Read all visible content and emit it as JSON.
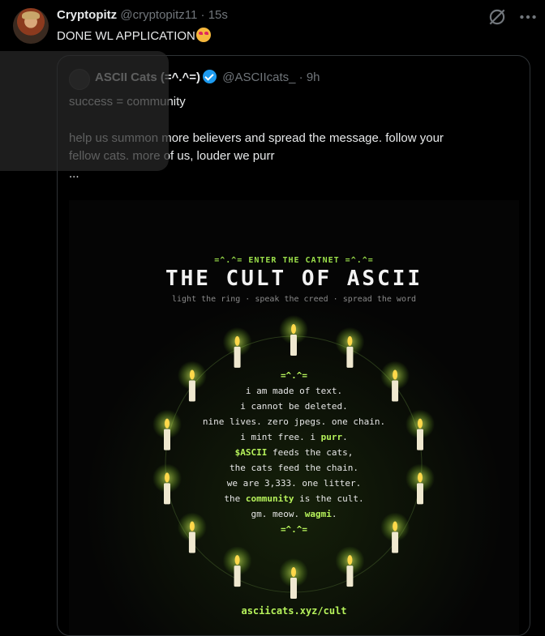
{
  "tweet": {
    "author_name": "Cryptopitz",
    "handle": "@cryptopitz11",
    "separator": "·",
    "time": "15s",
    "text": "DONE WL APPLICATION"
  },
  "quote": {
    "author_name": "ASCII Cats (=^.^=)",
    "handle": "@ASCIIcats_",
    "separator": "·",
    "time": "9h",
    "line1": "success = community",
    "line2": "help us summon more believers and spread the message. follow your",
    "line3": "fellow cats. more of us, louder we purr",
    "line4": "..."
  },
  "poster": {
    "kicker": "=^.^= ENTER THE CATNET =^.^=",
    "title": "THE CULT OF ASCII",
    "subtitle": "light the ring · speak the creed · spread the word",
    "face_top": "=^.^=",
    "creed": [
      {
        "pre": "i am made of text.",
        "hl": "",
        "post": ""
      },
      {
        "pre": "i cannot be deleted.",
        "hl": "",
        "post": ""
      },
      {
        "pre": "nine lives. zero jpegs. one chain.",
        "hl": "",
        "post": ""
      },
      {
        "pre": "i mint free. i ",
        "hl": "purr",
        "post": "."
      },
      {
        "pre": "",
        "hl": "$ASCII",
        "post": " feeds the cats,"
      },
      {
        "pre": "the cats feed the chain.",
        "hl": "",
        "post": ""
      },
      {
        "pre": "we are 3,333. one litter.",
        "hl": "",
        "post": ""
      },
      {
        "pre": "the ",
        "hl": "community",
        "post": " is the cult."
      },
      {
        "pre": "gm. meow. ",
        "hl": "wagmi",
        "post": "."
      }
    ],
    "face_bottom": "=^.^=",
    "url": "asciicats.xyz/cult",
    "candle_count": 14
  },
  "colors": {
    "accent_green": "#b6f25b",
    "verified_blue": "#1d9bf0",
    "muted": "#71767b"
  },
  "icons": [
    "grok-icon",
    "more-icon",
    "verified-icon",
    "candle-icon"
  ]
}
